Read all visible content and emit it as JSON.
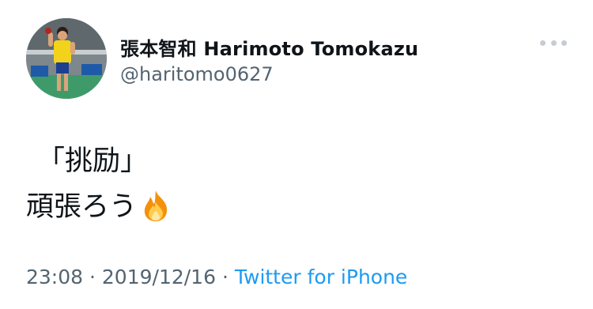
{
  "author": {
    "display_name": "張本智和 Harimoto Tomokazu",
    "handle": "@haritomo0627"
  },
  "tweet": {
    "lines": [
      "「挑励」",
      "頑張ろう"
    ],
    "emoji": "fire-icon"
  },
  "meta": {
    "time": "23:08",
    "separator": "·",
    "date": "2019/12/16",
    "source": "Twitter for iPhone"
  },
  "icons": {
    "more": "more-horizontal-icon",
    "fire": "fire-icon"
  },
  "colors": {
    "text": "#0f1419",
    "secondary": "#536471",
    "link": "#1d9bf0",
    "more_dots": "#c5ccd3"
  }
}
